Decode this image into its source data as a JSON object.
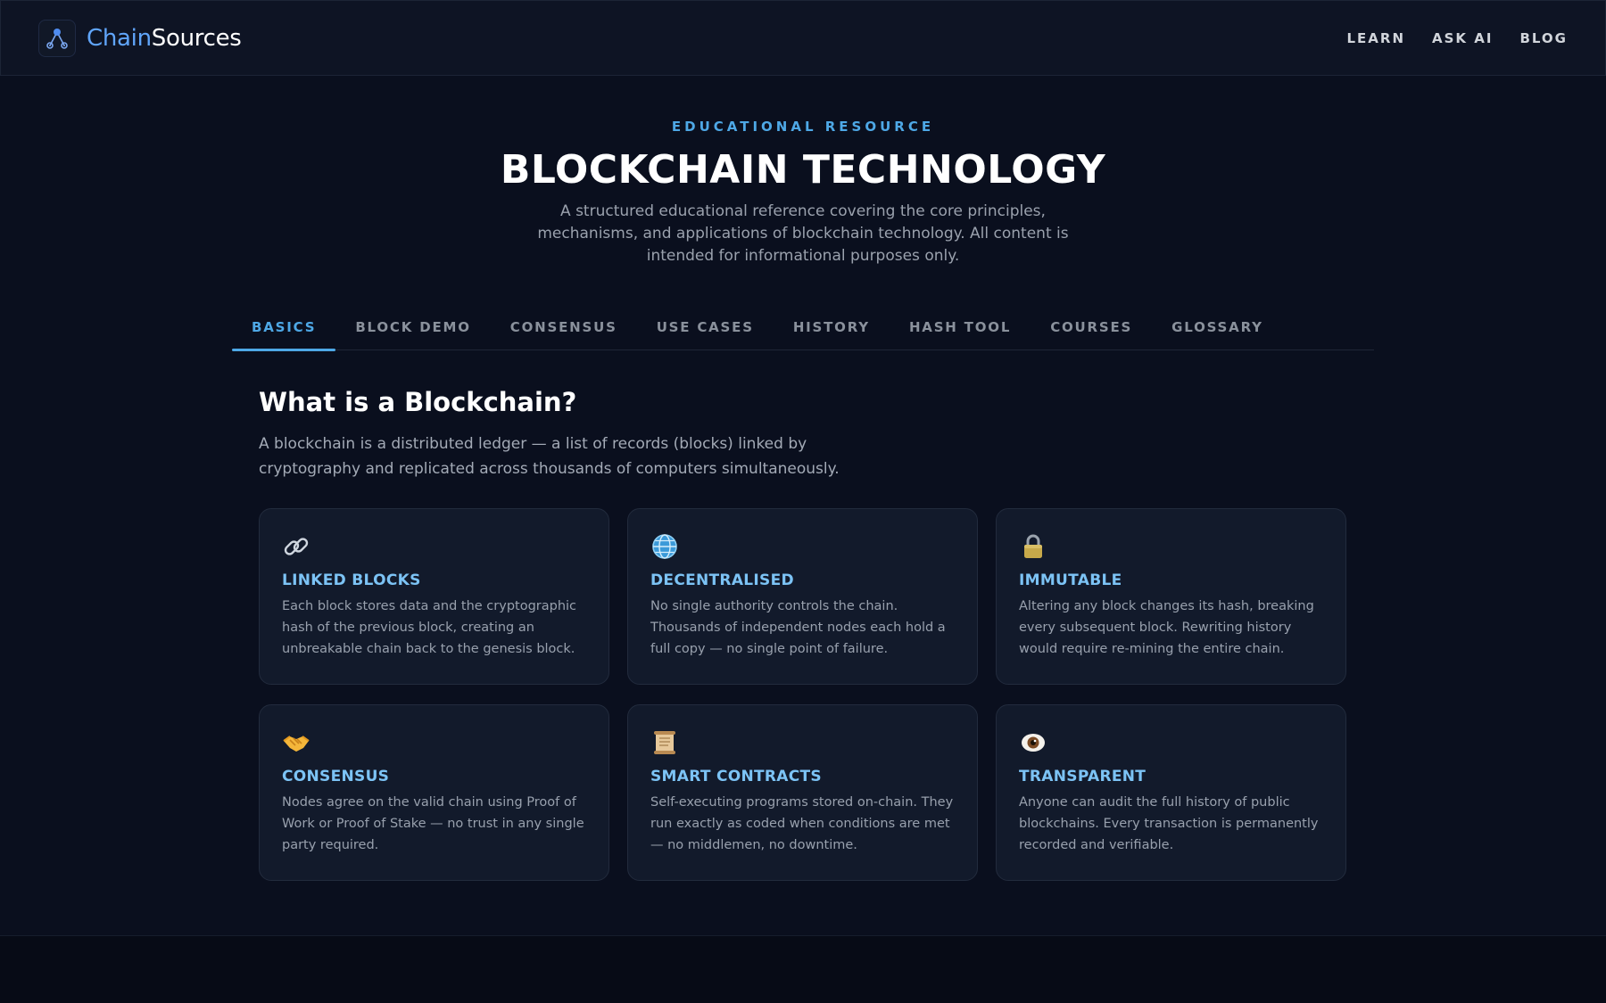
{
  "header": {
    "brand_part1": "Chain",
    "brand_part2": "Sources",
    "nav": [
      "LEARN",
      "ASK AI",
      "BLOG"
    ]
  },
  "hero": {
    "eyebrow": "EDUCATIONAL RESOURCE",
    "title": "BLOCKCHAIN TECHNOLOGY",
    "subtitle": "A structured educational reference covering the core principles, mechanisms, and applications of blockchain technology. All content is intended for informational purposes only."
  },
  "tabs": [
    "BASICS",
    "BLOCK DEMO",
    "CONSENSUS",
    "USE CASES",
    "HISTORY",
    "HASH TOOL",
    "COURSES",
    "GLOSSARY"
  ],
  "active_tab": "BASICS",
  "section": {
    "title": "What is a Blockchain?",
    "description": "A blockchain is a distributed ledger — a list of records (blocks) linked by cryptography and replicated across thousands of computers simultaneously."
  },
  "cards": [
    {
      "icon": "link-icon",
      "title": "LINKED BLOCKS",
      "text": "Each block stores data and the cryptographic hash of the previous block, creating an unbreakable chain back to the genesis block."
    },
    {
      "icon": "globe-icon",
      "title": "DECENTRALISED",
      "text": "No single authority controls the chain. Thousands of independent nodes each hold a full copy — no single point of failure."
    },
    {
      "icon": "lock-icon",
      "title": "IMMUTABLE",
      "text": "Altering any block changes its hash, breaking every subsequent block. Rewriting history would require re-mining the entire chain."
    },
    {
      "icon": "handshake-icon",
      "title": "CONSENSUS",
      "text": "Nodes agree on the valid chain using Proof of Work or Proof of Stake — no trust in any single party required."
    },
    {
      "icon": "scroll-icon",
      "title": "SMART CONTRACTS",
      "text": "Self-executing programs stored on-chain. They run exactly as coded when conditions are met — no middlemen, no downtime."
    },
    {
      "icon": "eye-icon",
      "title": "TRANSPARENT",
      "text": "Anyone can audit the full history of public blockchains. Every transaction is permanently recorded and verifiable."
    }
  ],
  "colors": {
    "accent": "#4ea8e6",
    "card_title": "#7cc3f5",
    "background": "#0a0f1e",
    "card_bg": "#121a2b"
  }
}
